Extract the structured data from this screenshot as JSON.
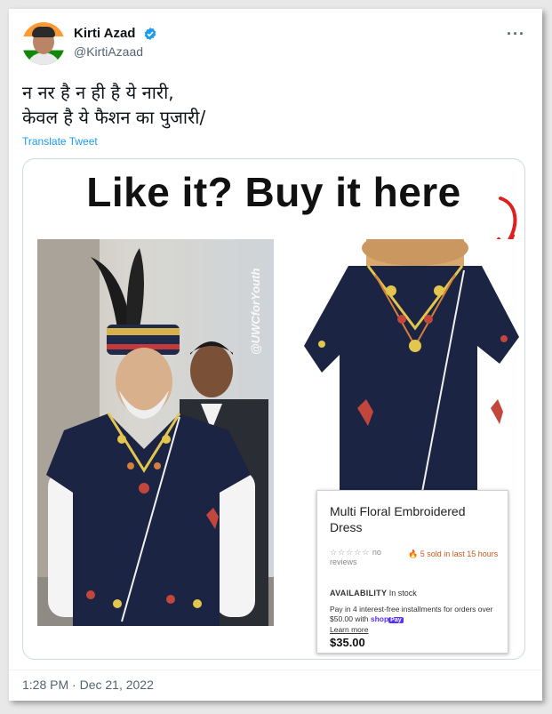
{
  "tweet": {
    "display_name": "Kirti Azad",
    "handle": "@KirtiAzaad",
    "verified": true,
    "more_label": "···",
    "text_line1": "न नर है न ही है ये नारी,",
    "text_line2": "केवल है ये फैशन का पुजारी/",
    "translate_label": "Translate Tweet",
    "timestamp": "1:28 PM · Dec 21, 2022"
  },
  "media": {
    "headline": "Like it? Buy it here",
    "watermark": "@UWCforYouth",
    "product": {
      "title": "Multi Floral Embroidered Dress",
      "stars": "☆☆☆☆☆",
      "no_reviews": "no reviews",
      "sold": "5 sold in last 15 hours",
      "availability_label": "AVAILABILITY",
      "availability_value": "In stock",
      "installments": "Pay in 4 interest-free installments for orders over $50.00 with",
      "shop_label": "shop",
      "pay_label": "Pay",
      "learn_more": "Learn more",
      "price": "$35.00"
    }
  },
  "colors": {
    "accent": "#1d9bf0",
    "garment": "#1b2442",
    "arrow": "#e02020",
    "sold": "#c65a1e"
  },
  "icons": {
    "verified": "verified-badge-icon",
    "more": "more-icon",
    "fire": "fire-icon",
    "arrow": "curved-arrow-icon"
  }
}
